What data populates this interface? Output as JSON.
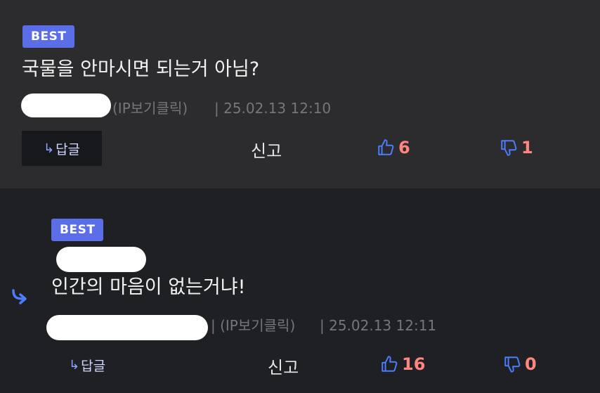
{
  "colors": {
    "badge": "#5b6ee8",
    "count": "#ff8580",
    "icon_blue": "#4b7dff"
  },
  "comments": [
    {
      "badge": "BEST",
      "text": "국물을 안마시면 되는거 아님?",
      "ip_label": "(IP보기클릭)",
      "timestamp": "| 25.02.13 12:10",
      "reply_label": "답글",
      "report_label": "신고",
      "likes": "6",
      "dislikes": "1"
    },
    {
      "badge": "BEST",
      "text": "인간의 마음이 없는거냐!",
      "ip_label": "| (IP보기클릭)",
      "timestamp": "| 25.02.13 12:11",
      "reply_label": "답글",
      "report_label": "신고",
      "likes": "16",
      "dislikes": "0"
    }
  ],
  "icons": {
    "reply_arrow": "reply-arrow-icon",
    "thumbs_up": "thumbs-up-icon",
    "thumbs_down": "thumbs-down-icon",
    "reply_indicator": "reply-indicator-icon"
  }
}
